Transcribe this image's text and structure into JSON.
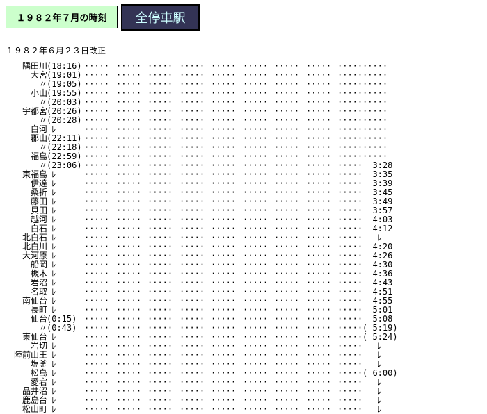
{
  "header": {
    "timetable_label": "１９８２年７月の時刻",
    "all_stations_label": "全停車駅"
  },
  "revision_note": "１９８２年６月２３日改正",
  "dots_text": "·····",
  "stations": [
    {
      "name": "隅田川",
      "time": "(18:16)",
      "last": "·····"
    },
    {
      "name": "大宮",
      "time": "(19:01)",
      "last": "·····"
    },
    {
      "name": "〃",
      "time": "(19:05)",
      "last": "·····"
    },
    {
      "name": "小山",
      "time": "(19:55)",
      "last": "·····"
    },
    {
      "name": "〃",
      "time": "(20:03)",
      "last": "·····"
    },
    {
      "name": "宇都宮",
      "time": "(20:26)",
      "last": "·····"
    },
    {
      "name": "〃",
      "time": "(20:28)",
      "last": "·····"
    },
    {
      "name": "白河",
      "time": " ﾚ",
      "last": "·····"
    },
    {
      "name": "郡山",
      "time": "(22:11)",
      "last": "·····"
    },
    {
      "name": "〃",
      "time": "(22:18)",
      "last": "·····"
    },
    {
      "name": "福島",
      "time": "(22:59)",
      "last": "·····"
    },
    {
      "name": "〃",
      "time": "(23:06)",
      "last": "  3:28"
    },
    {
      "name": "東福島",
      "time": " ﾚ",
      "last": "  3:35"
    },
    {
      "name": "伊達",
      "time": " ﾚ",
      "last": "  3:39"
    },
    {
      "name": "桑折",
      "time": " ﾚ",
      "last": "  3:45"
    },
    {
      "name": "藤田",
      "time": " ﾚ",
      "last": "  3:49"
    },
    {
      "name": "貝田",
      "time": " ﾚ",
      "last": "  3:57"
    },
    {
      "name": "越河",
      "time": " ﾚ",
      "last": "  4:03"
    },
    {
      "name": "白石",
      "time": " ﾚ",
      "last": "  4:12"
    },
    {
      "name": "北白石",
      "time": " ﾚ",
      "last": "   ﾚ"
    },
    {
      "name": "北白川",
      "time": " ﾚ",
      "last": "  4:20"
    },
    {
      "name": "大河原",
      "time": " ﾚ",
      "last": "  4:26"
    },
    {
      "name": "船岡",
      "time": " ﾚ",
      "last": "  4:30"
    },
    {
      "name": "槻木",
      "time": " ﾚ",
      "last": "  4:36"
    },
    {
      "name": "岩沼",
      "time": " ﾚ",
      "last": "  4:43"
    },
    {
      "name": "名取",
      "time": " ﾚ",
      "last": "  4:51"
    },
    {
      "name": "南仙台",
      "time": " ﾚ",
      "last": "  4:55"
    },
    {
      "name": "長町",
      "time": " ﾚ",
      "last": "  5:01"
    },
    {
      "name": "仙台",
      "time": "(0:15)",
      "last": "  5:08"
    },
    {
      "name": "〃",
      "time": "(0:43)",
      "last": "( 5:19)"
    },
    {
      "name": "東仙台",
      "time": " ﾚ",
      "last": "( 5:24)"
    },
    {
      "name": "岩切",
      "time": " ﾚ",
      "last": "   ﾚ"
    },
    {
      "name": "陸前山王",
      "time": " ﾚ",
      "last": "   ﾚ"
    },
    {
      "name": "塩釜",
      "time": " ﾚ",
      "last": "   ﾚ"
    },
    {
      "name": "松島",
      "time": " ﾚ",
      "last": "( 6:00)"
    },
    {
      "name": "愛宕",
      "time": " ﾚ",
      "last": "   ﾚ"
    },
    {
      "name": "品井沼",
      "time": " ﾚ",
      "last": "   ﾚ"
    },
    {
      "name": "鹿島台",
      "time": " ﾚ",
      "last": "   ﾚ"
    },
    {
      "name": "松山町",
      "time": " ﾚ",
      "last": "   ﾚ"
    }
  ]
}
